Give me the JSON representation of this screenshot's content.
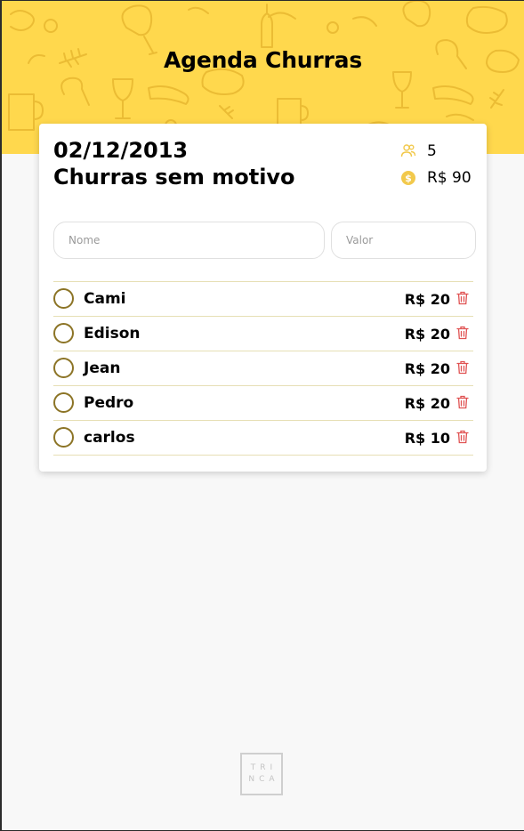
{
  "header": {
    "title": "Agenda Churras"
  },
  "event": {
    "date": "02/12/2013",
    "name": "Churras sem motivo",
    "participant_count": "5",
    "total": "R$ 90"
  },
  "form": {
    "name_placeholder": "Nome",
    "value_placeholder": "Valor"
  },
  "participants": [
    {
      "name": "Cami",
      "value": "R$ 20"
    },
    {
      "name": "Edison",
      "value": "R$ 20"
    },
    {
      "name": "Jean",
      "value": "R$ 20"
    },
    {
      "name": "Pedro",
      "value": "R$ 20"
    },
    {
      "name": "carlos",
      "value": "R$ 10"
    }
  ],
  "footer": {
    "logo_line1": "TRI",
    "logo_line2": "NCA"
  },
  "colors": {
    "hero": "#ffd84d",
    "accent": "#ffd84d",
    "check_border": "#8c7426",
    "trash": "#e05252",
    "divider": "#e6dfb5"
  },
  "icons": {
    "people": "people-icon",
    "money": "dollar-coin-icon",
    "delete": "trash-icon",
    "check": "circle-check-icon"
  }
}
